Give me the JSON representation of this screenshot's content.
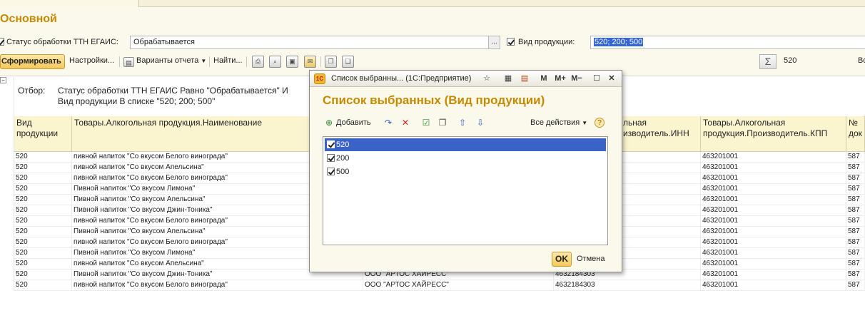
{
  "form": {
    "title": "Основной",
    "status_checkbox_label": "Статус обработки ТТН ЕГАИС:",
    "status_value": "Обрабатывается",
    "ellipsis": "...",
    "product_checkbox_label": "Вид продукции:",
    "product_value": "520; 200; 500"
  },
  "toolbar": {
    "generate": "Сформировать",
    "settings": "Настройки...",
    "variants": "Варианты отчета",
    "find": "Найти...",
    "sum_value": "520",
    "right_cut": "Во"
  },
  "report": {
    "filter_label": "Отбор:",
    "filter_line1": "Статус обработки ТТН ЕГАИС Равно \"Обрабатывается\" И",
    "filter_line2": "Вид продукции В списке \"520; 200; 500\"",
    "columns": {
      "vid1": "Вид",
      "vid2": "продукции",
      "name": "Товары.Алкогольная продукция.Наименование",
      "inn1": "льная",
      "inn2": "изводитель.ИНН",
      "kpp1": "Товары.Алкогольная",
      "kpp2": "продукция.Производитель.КПП",
      "no1": "№",
      "no2": "док"
    },
    "rows": [
      {
        "vid": "520",
        "name": "пивной напиток \"Со вкусом Белого винограда\"",
        "maker": "",
        "inn": "",
        "kpp": "463201001",
        "no": "587"
      },
      {
        "vid": "520",
        "name": "пивной напиток \"Со вкусом Апельсина\"",
        "maker": "",
        "inn": "",
        "kpp": "463201001",
        "no": "587"
      },
      {
        "vid": "520",
        "name": "пивной напиток \"Со вкусом Белого винограда\"",
        "maker": "",
        "inn": "",
        "kpp": "463201001",
        "no": "587"
      },
      {
        "vid": "520",
        "name": "Пивной напиток \"Со вкусом Лимона\"",
        "maker": "",
        "inn": "",
        "kpp": "463201001",
        "no": "587"
      },
      {
        "vid": "520",
        "name": "Пивной напиток \"Со вкусом Апельсина\"",
        "maker": "",
        "inn": "",
        "kpp": "463201001",
        "no": "587"
      },
      {
        "vid": "520",
        "name": "Пивной напиток \"Со вкусом Джин-Тоника\"",
        "maker": "",
        "inn": "",
        "kpp": "463201001",
        "no": "587"
      },
      {
        "vid": "520",
        "name": "пивной напиток \"Со вкусом Белого винограда\"",
        "maker": "",
        "inn": "",
        "kpp": "463201001",
        "no": "587"
      },
      {
        "vid": "520",
        "name": "Пивной напиток \"Со вкусом Апельсина\"",
        "maker": "",
        "inn": "",
        "kpp": "463201001",
        "no": "587"
      },
      {
        "vid": "520",
        "name": "пивной напиток \"Со вкусом Белого винограда\"",
        "maker": "",
        "inn": "",
        "kpp": "463201001",
        "no": "587"
      },
      {
        "vid": "520",
        "name": "Пивной напиток \"Со вкусом Лимона\"",
        "maker": "",
        "inn": "",
        "kpp": "463201001",
        "no": "587"
      },
      {
        "vid": "520",
        "name": "пивной напиток \"Со вкусом Апельсина\"",
        "maker": "",
        "inn": "",
        "kpp": "463201001",
        "no": "587"
      },
      {
        "vid": "520",
        "name": "Пивной напиток \"Со вкусом Джин-Тоника\"",
        "maker": "ООО \"АРТОС ХАЙРЕСС\"",
        "inn": "4632184303",
        "kpp": "463201001",
        "no": "587"
      },
      {
        "vid": "520",
        "name": "пивной напиток \"Со вкусом Белого винограда\"",
        "maker": "ООО \"АРТОС ХАЙРЕСС\"",
        "inn": "4632184303",
        "kpp": "463201001",
        "no": "587"
      }
    ]
  },
  "dialog": {
    "window_title": "Список выбранны... (1С:Предприятие)",
    "heading": "Список выбранных (Вид продукции)",
    "add": "Добавить",
    "all_actions": "Все действия",
    "m": "M",
    "m_plus": "M+",
    "m_minus": "M−",
    "items": [
      {
        "label": "520",
        "checked": true,
        "selected": true
      },
      {
        "label": "200",
        "checked": true,
        "selected": false
      },
      {
        "label": "500",
        "checked": true,
        "selected": false
      }
    ],
    "ok": "OK",
    "cancel": "Отмена"
  }
}
